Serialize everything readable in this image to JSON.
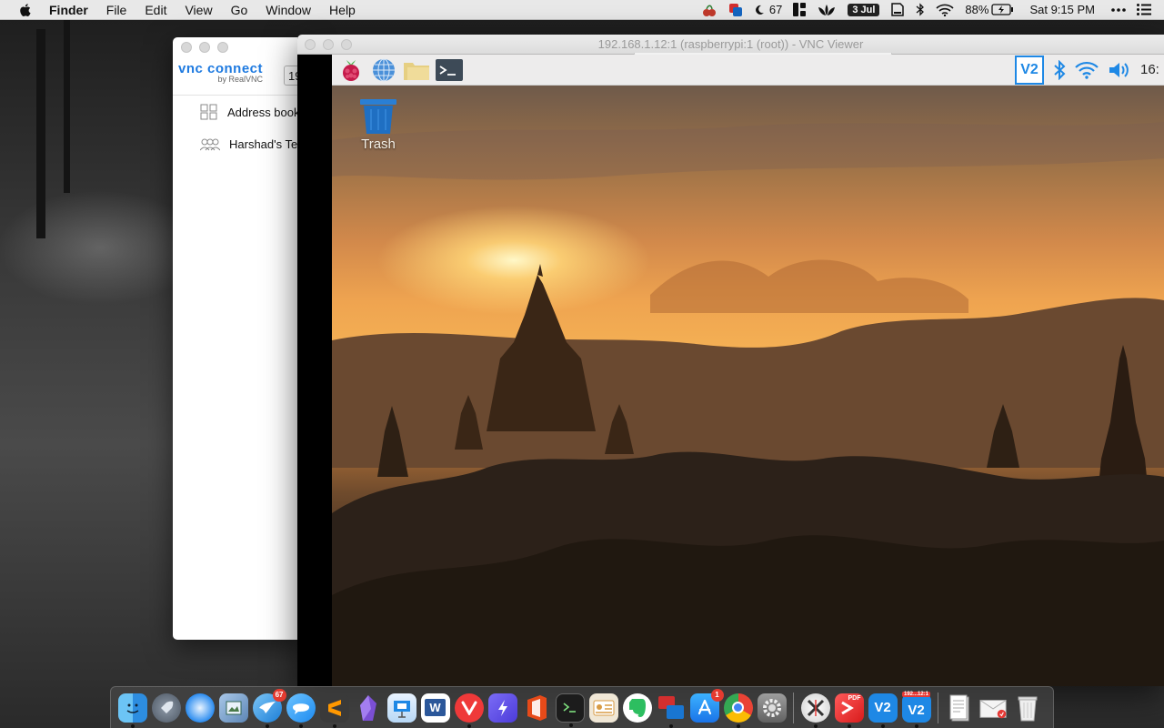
{
  "menubar": {
    "app_name": "Finder",
    "items": [
      "File",
      "Edit",
      "View",
      "Go",
      "Window",
      "Help"
    ],
    "status": {
      "temperature": "67",
      "date_badge": "3 Jul",
      "battery": "88%",
      "clock": "Sat 9:15 PM"
    }
  },
  "vnc_connect": {
    "brand_main": "vnc connect",
    "brand_sub": "by RealVNC",
    "address_value": "19",
    "nav": {
      "address_book": "Address book",
      "team": "Harshad's Team"
    }
  },
  "vnc_viewer": {
    "title": "192.168.1.12:1 (raspberrypi:1 (root)) - VNC Viewer",
    "taskbar": {
      "vnc_tray_label": "V2",
      "time_partial": "16:"
    },
    "desktop": {
      "trash_label": "Trash"
    }
  },
  "dock": {
    "mail_badge": "67",
    "appstore_badge": "1",
    "word_label": "W",
    "vnc_label": "V2",
    "vnc_viewer_label": "192...12:1",
    "vnc_viewer_sub": "V2",
    "pdf_label": "PDF"
  },
  "colors": {
    "vnc_brand": "#1e7ae0",
    "desktop_sky": "#efa450",
    "trash_blue": "#1f6fc2"
  }
}
